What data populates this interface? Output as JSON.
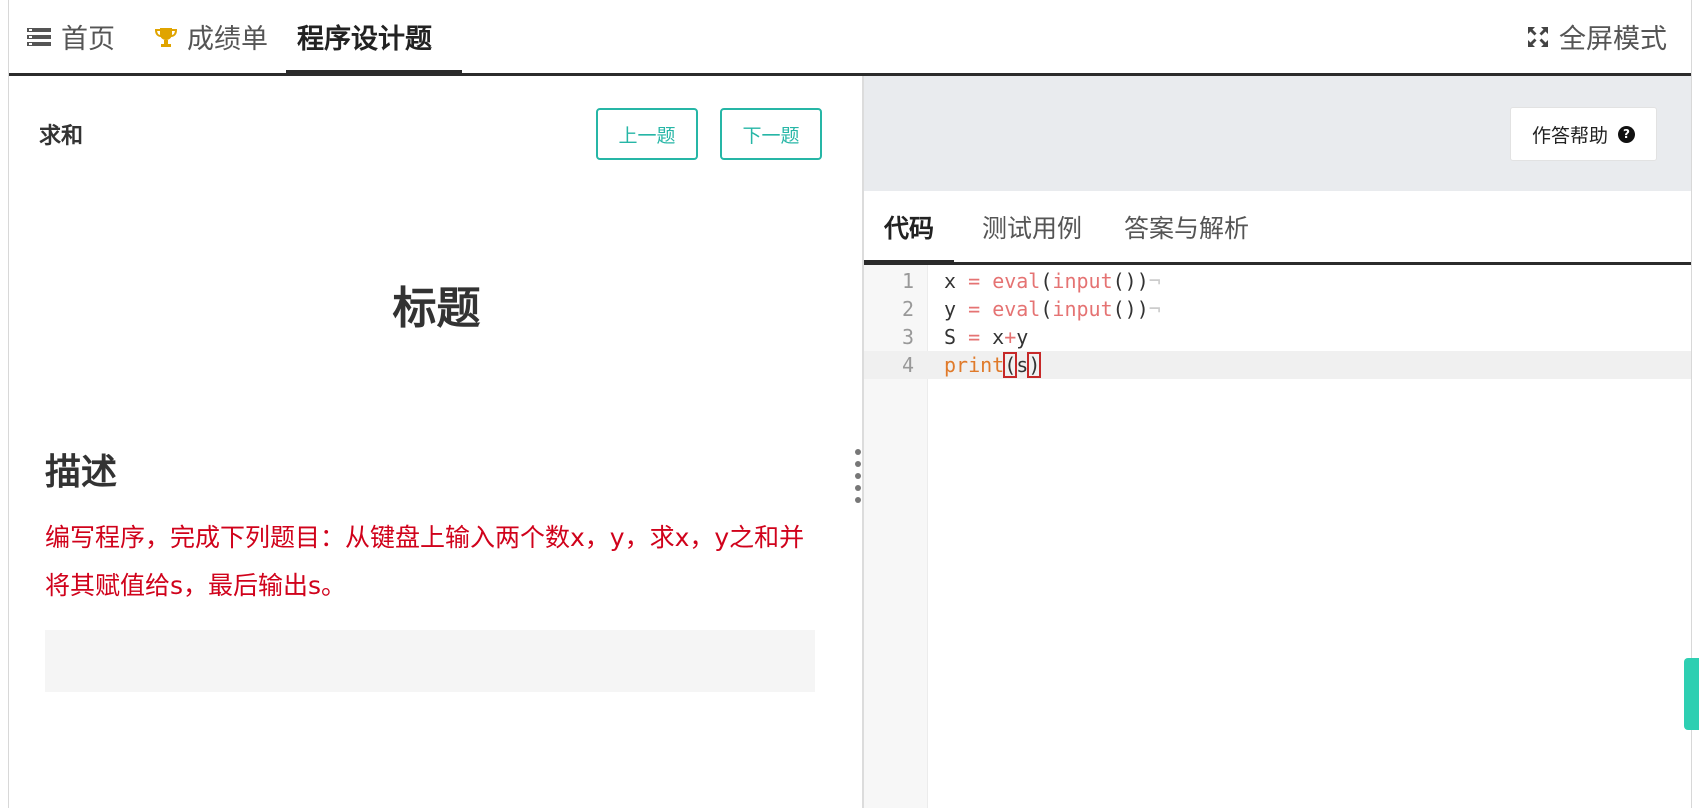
{
  "nav": {
    "home": "首页",
    "scores": "成绩单",
    "programming": "程序设计题",
    "fullscreen": "全屏模式"
  },
  "question": {
    "name": "求和",
    "prev_label": "上一题",
    "next_label": "下一题",
    "heading": "标题",
    "desc_heading": "描述",
    "description": "编写程序，完成下列题目：从键盘上输入两个数x，y，求x，y之和并将其赋值给s，最后输出s。"
  },
  "editor_panel": {
    "help_label": "作答帮助",
    "tabs": [
      "代码",
      "测试用例",
      "答案与解析"
    ],
    "active_tab": "代码"
  },
  "code": {
    "line_numbers": [
      "1",
      "2",
      "3",
      "4"
    ],
    "lines": [
      "x = eval(input())",
      "y = eval(input())",
      "S = x+y",
      "print(s)"
    ],
    "active_line": 4
  },
  "colors": {
    "accent": "#26b6a6",
    "description_red": "#d0021b",
    "keyword": "#e57373",
    "builtin": "#e07a2a"
  },
  "icons": {
    "home": "list-icon",
    "scores": "trophy-icon",
    "fullscreen": "expand-icon",
    "help": "question-circle-icon"
  }
}
